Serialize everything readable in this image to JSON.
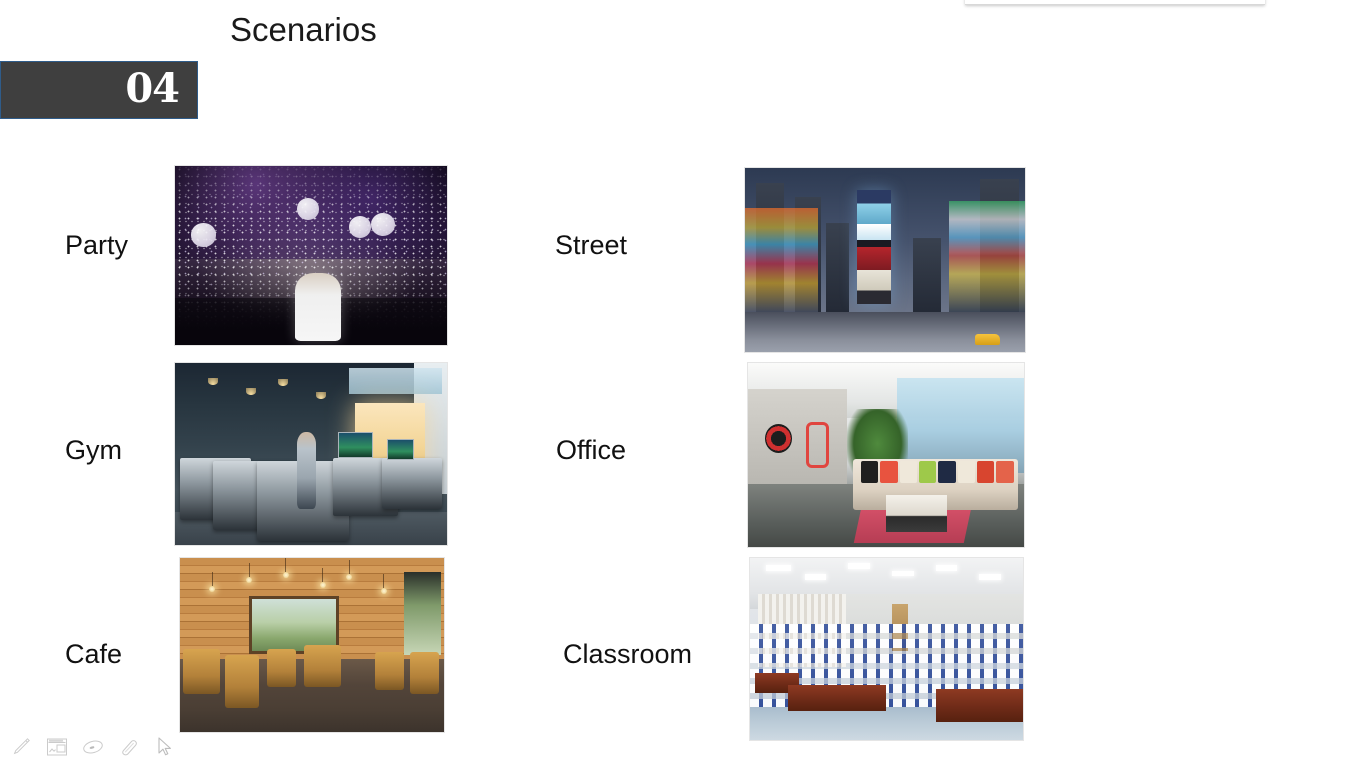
{
  "slide": {
    "background_color": "#ffffff",
    "section": {
      "number": "04",
      "title": "Scenarios",
      "box_color": "#3f3f3f",
      "box_border_color": "#2f5c8a",
      "number_color": "#ffffff",
      "title_color": "#1a1a1a"
    },
    "scenarios": [
      {
        "label": "Party",
        "photo_name": "party-photo",
        "alt": "DJ performing on stage with confetti falling over a crowd"
      },
      {
        "label": "Street",
        "photo_name": "street-photo",
        "alt": "Times Square city street at dusk with illuminated billboards"
      },
      {
        "label": "Gym",
        "photo_name": "gym-photo",
        "alt": "Gym interior with rows of treadmills and a person running"
      },
      {
        "label": "Office",
        "photo_name": "office-photo",
        "alt": "Modern office lounge with sofa, colorful pillows and plants"
      },
      {
        "label": "Cafe",
        "photo_name": "cafe-photo",
        "alt": "Wood panelled cafe interior with tables, chairs and pendant lights"
      },
      {
        "label": "Classroom",
        "photo_name": "classroom-photo",
        "alt": "Lecture hall with rows of blue and white seats and wooden desks"
      }
    ]
  },
  "annotation_toolbar": {
    "tools": [
      {
        "name": "pen-icon",
        "label": "Pen"
      },
      {
        "name": "slide-thumbnail-icon",
        "label": "Slide view"
      },
      {
        "name": "lasso-icon",
        "label": "Lasso select"
      },
      {
        "name": "eraser-icon",
        "label": "Eraser"
      },
      {
        "name": "cursor-icon",
        "label": "Pointer"
      }
    ]
  }
}
